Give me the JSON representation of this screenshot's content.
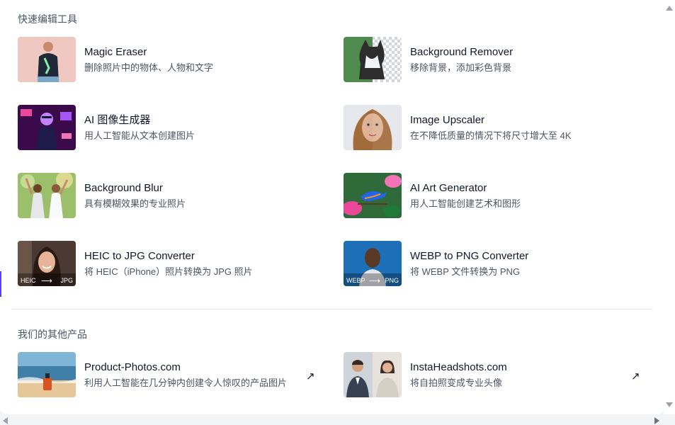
{
  "sections": {
    "quick_tools_title": "快速编辑工具",
    "other_products_title": "我们的其他产品"
  },
  "tools": [
    {
      "title": "Magic Eraser",
      "desc": "删除照片中的物体、人物和文字",
      "thumb": "magic-eraser-thumbnail"
    },
    {
      "title": "Background Remover",
      "desc": "移除背景，添加彩色背景",
      "thumb": "background-remover-thumbnail"
    },
    {
      "title": "AI 图像生成器",
      "desc": "用人工智能从文本创建图片",
      "thumb": "ai-image-generator-thumbnail"
    },
    {
      "title": "Image Upscaler",
      "desc": "在不降低质量的情况下将尺寸增大至 4K",
      "thumb": "image-upscaler-thumbnail"
    },
    {
      "title": "Background Blur",
      "desc": "具有模糊效果的专业照片",
      "thumb": "background-blur-thumbnail"
    },
    {
      "title": "AI Art Generator",
      "desc": "用人工智能创建艺术和图形",
      "thumb": "ai-art-generator-thumbnail"
    },
    {
      "title": "HEIC to JPG Converter",
      "desc": "将 HEIC（iPhone）照片转换为 JPG 照片",
      "thumb": "heic-to-jpg-thumbnail",
      "from": "HEIC",
      "to": "JPG"
    },
    {
      "title": "WEBP to PNG Converter",
      "desc": "将 WEBP 文件转换为 PNG",
      "thumb": "webp-to-png-thumbnail",
      "from": "WEBP",
      "to": "PNG"
    }
  ],
  "products": [
    {
      "title": "Product-Photos.com",
      "desc": "利用人工智能在几分钟内创建令人惊叹的产品图片",
      "icon": "external-link-icon"
    },
    {
      "title": "InstaHeadshots.com",
      "desc": "将自拍照变成专业头像",
      "icon": "external-link-icon"
    }
  ],
  "glyphs": {
    "external": "↗",
    "convert_arrow": "⟶"
  }
}
